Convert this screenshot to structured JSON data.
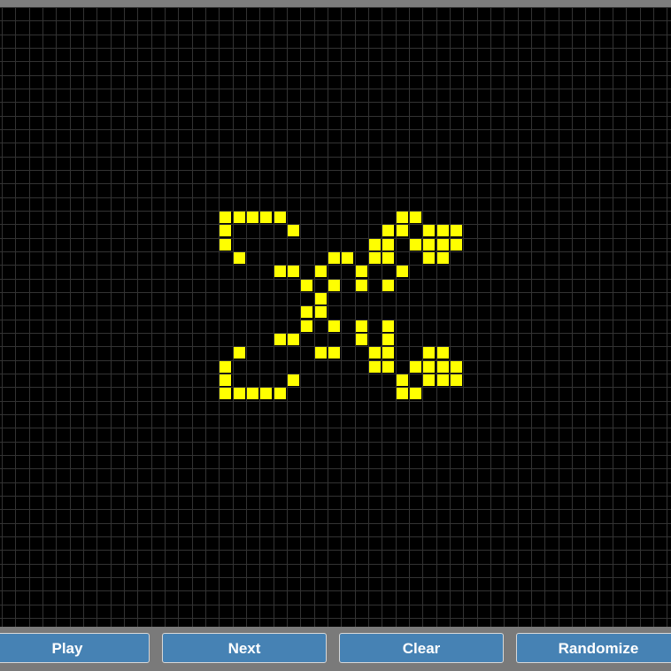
{
  "controls": {
    "play_label": "Play",
    "next_label": "Next",
    "clear_label": "Clear",
    "randomize_label": "Randomize"
  },
  "colors": {
    "background": "#000000",
    "grid_line": "#333333",
    "live_cell": "#ffff00",
    "button": "#4682b4",
    "button_text": "#ffffff",
    "chrome": "#7a7a7a"
  },
  "board": {
    "live_cells": [
      [
        16,
        15
      ],
      [
        17,
        15
      ],
      [
        18,
        15
      ],
      [
        19,
        15
      ],
      [
        20,
        15
      ],
      [
        29,
        15
      ],
      [
        30,
        15
      ],
      [
        16,
        16
      ],
      [
        21,
        16
      ],
      [
        28,
        16
      ],
      [
        29,
        16
      ],
      [
        31,
        16
      ],
      [
        32,
        16
      ],
      [
        33,
        16
      ],
      [
        16,
        17
      ],
      [
        27,
        17
      ],
      [
        28,
        17
      ],
      [
        30,
        17
      ],
      [
        31,
        17
      ],
      [
        32,
        17
      ],
      [
        33,
        17
      ],
      [
        17,
        18
      ],
      [
        24,
        18
      ],
      [
        25,
        18
      ],
      [
        27,
        18
      ],
      [
        28,
        18
      ],
      [
        31,
        18
      ],
      [
        32,
        18
      ],
      [
        20,
        19
      ],
      [
        21,
        19
      ],
      [
        23,
        19
      ],
      [
        26,
        19
      ],
      [
        29,
        19
      ],
      [
        22,
        20
      ],
      [
        24,
        20
      ],
      [
        26,
        20
      ],
      [
        28,
        20
      ],
      [
        23,
        21
      ],
      [
        22,
        22
      ],
      [
        23,
        22
      ],
      [
        22,
        23
      ],
      [
        24,
        23
      ],
      [
        26,
        23
      ],
      [
        28,
        23
      ],
      [
        20,
        24
      ],
      [
        21,
        24
      ],
      [
        26,
        24
      ],
      [
        28,
        24
      ],
      [
        17,
        25
      ],
      [
        23,
        25
      ],
      [
        24,
        25
      ],
      [
        27,
        25
      ],
      [
        28,
        25
      ],
      [
        31,
        25
      ],
      [
        32,
        25
      ],
      [
        16,
        26
      ],
      [
        27,
        26
      ],
      [
        28,
        26
      ],
      [
        30,
        26
      ],
      [
        31,
        26
      ],
      [
        32,
        26
      ],
      [
        33,
        26
      ],
      [
        16,
        27
      ],
      [
        21,
        27
      ],
      [
        29,
        27
      ],
      [
        31,
        27
      ],
      [
        32,
        27
      ],
      [
        33,
        27
      ],
      [
        16,
        28
      ],
      [
        17,
        28
      ],
      [
        18,
        28
      ],
      [
        19,
        28
      ],
      [
        20,
        28
      ],
      [
        29,
        28
      ],
      [
        30,
        28
      ]
    ]
  }
}
